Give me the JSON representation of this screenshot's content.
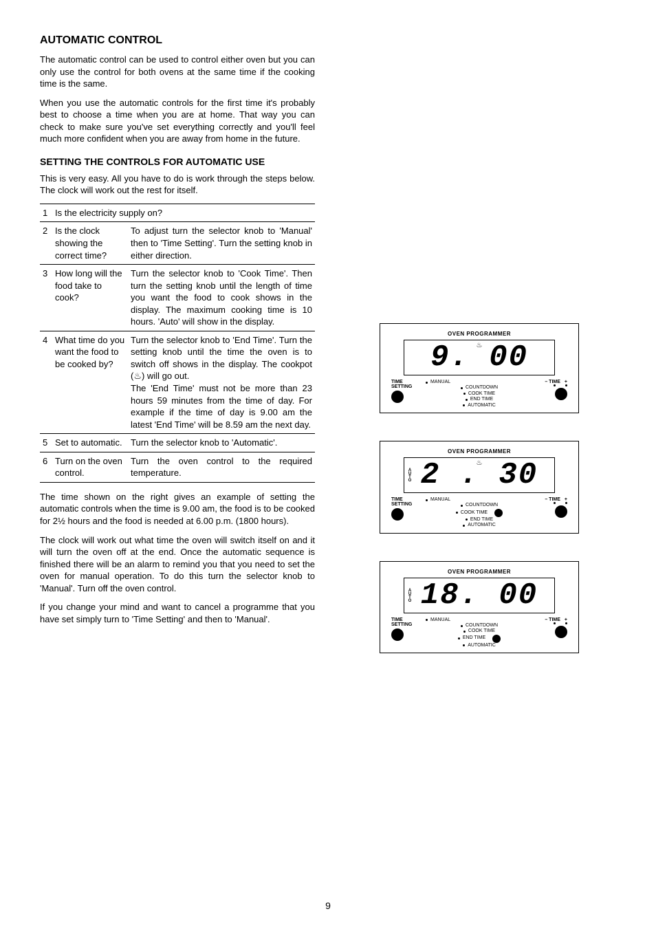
{
  "heading_main": "AUTOMATIC CONTROL",
  "para1": "The automatic control can be used to control either oven but you can only use the control for both ovens at the same time if the cooking time is the same.",
  "para2": "When you use the automatic controls for the first time it's probably best to choose a time when you are at home.  That way you can check to make sure you've set everything correctly and you'll feel much more confident when you are away from home in the future.",
  "heading_sub": "SETTING THE CONTROLS FOR AUTOMATIC USE",
  "para3": "This is very easy.  All you have to do is work through the steps below.  The clock will work out the rest for itself.",
  "steps": [
    {
      "n": "1",
      "q": "Is the electricity supply on?",
      "a": ""
    },
    {
      "n": "2",
      "q": "Is the clock showing the correct time?",
      "a": "To adjust turn the selector knob to 'Manual' then to 'Time Setting'. Turn the setting knob in either direction."
    },
    {
      "n": "3",
      "q": "How long will the food take to cook?",
      "a": "Turn the selector knob to 'Cook Time'. Then turn the setting knob until the length of time you want the food to cook shows in the display.  The maximum cooking time is 10 hours.  'Auto' will show in the display."
    },
    {
      "n": "4",
      "q": "What time do you want the food to be cooked by?",
      "a": "Turn the selector knob to 'End Time'.  Turn the setting knob until the time the oven is to switch off shows in the display. The cookpot (♨) will go out.\nThe 'End Time' must not be more than 23 hours 59 minutes from the time of day. For example if the time of day is 9.00 am the latest 'End Time' will be 8.59 am the next day."
    },
    {
      "n": "5",
      "q": "Set to automatic.",
      "a": "Turn the selector knob to 'Automatic'."
    },
    {
      "n": "6",
      "q": "Turn on the oven control.",
      "a": "Turn the oven control to the required temperature."
    }
  ],
  "para4": "The time shown on the right gives an example of setting the automatic controls when the time is 9.00 am, the food is to be cooked for 2½ hours and the food is needed at 6.00 p.m. (1800 hours).",
  "para5": "The clock will work out what time the oven will switch itself on and it will turn the oven off at the end.  Once the automatic sequence is finished there will be an alarm to remind you that you need to set the oven for manual operation.  To do this turn the selector knob to 'Manual'. Turn off the oven control.",
  "para6": "If you change your mind and want to cancel a programme that you have set simply turn to 'Time Setting' and then to 'Manual'.",
  "panel": {
    "title": "OVEN PROGRAMMER",
    "left_knob_line1": "TIME",
    "left_knob_line2": "SETTING",
    "right_time_minus": "–  TIME",
    "right_time_plus": "+",
    "mode_manual": "MANUAL",
    "mode_countdown": "COUNTDOWN",
    "mode_cooktime": "COOK TIME",
    "mode_endtime": "END TIME",
    "mode_automatic": "AUTOMATIC",
    "auto_strip": "AUTO",
    "cookpot": "♨"
  },
  "displays": {
    "d1": "9. 00",
    "d2": "2 . 30",
    "d3": "18. 00"
  },
  "page_number": "9"
}
